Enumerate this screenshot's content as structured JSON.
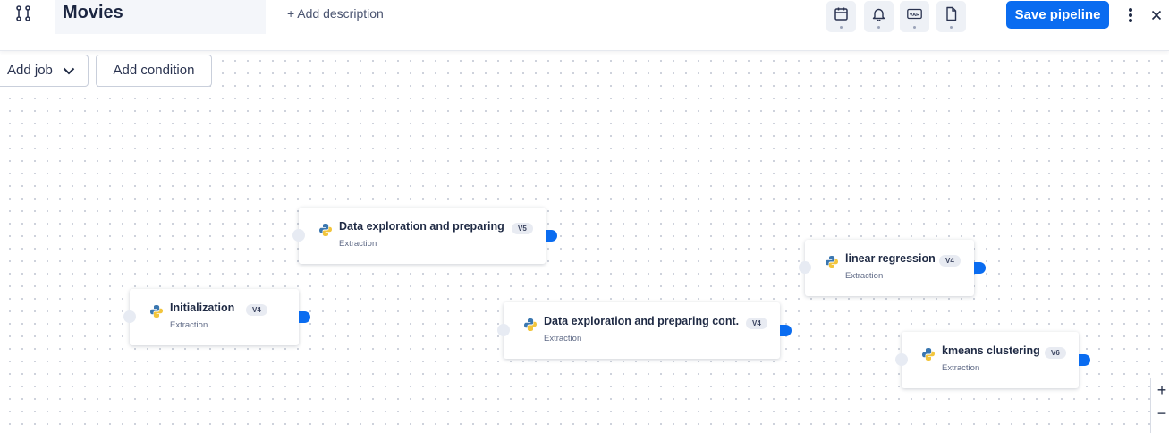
{
  "header": {
    "title": "Movies",
    "add_description": "+ Add description",
    "save_label": "Save pipeline",
    "tools": [
      "calendar-icon",
      "bell-icon",
      "var-icon",
      "document-icon"
    ],
    "var_label": "VAR"
  },
  "toolbar": {
    "add_job_label": "Add job",
    "add_condition_label": "Add condition"
  },
  "jobs": [
    {
      "name": "Data exploration and preparing",
      "version": "V5",
      "type": "Extraction"
    },
    {
      "name": "Initialization",
      "version": "V4",
      "type": "Extraction"
    },
    {
      "name": "Data exploration and preparing cont.",
      "version": "V4",
      "type": "Extraction"
    },
    {
      "name": "linear regression",
      "version": "V4",
      "type": "Extraction"
    },
    {
      "name": "kmeans clustering",
      "version": "V6",
      "type": "Extraction"
    }
  ],
  "zoom": {
    "plus": "+",
    "minus": "−"
  },
  "colors": {
    "accent": "#0a6cf0",
    "title_bg": "#f4f6fa",
    "port_in": "#e7ebf3"
  }
}
